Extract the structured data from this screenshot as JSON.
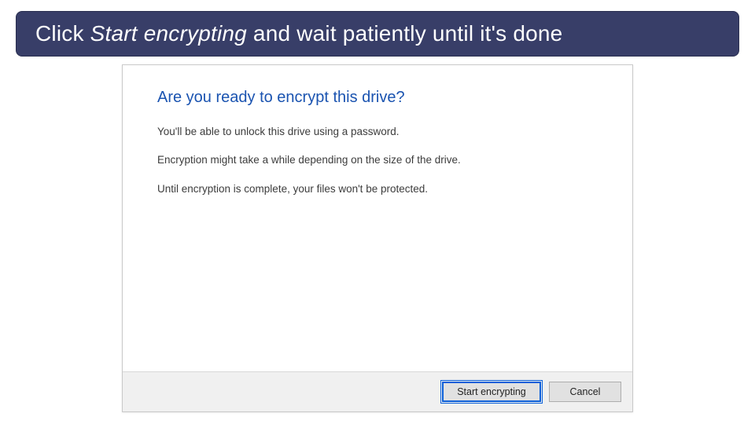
{
  "banner": {
    "pre": "Click ",
    "em": "Start encrypting",
    "post": " and wait patiently until it's done"
  },
  "dialog": {
    "heading": "Are you ready to encrypt this drive?",
    "line1": "You'll be able to unlock this drive using a password.",
    "line2": "Encryption might take a while depending on the size of the drive.",
    "line3": "Until encryption is complete, your files won't be protected.",
    "buttons": {
      "primary": "Start encrypting",
      "cancel": "Cancel"
    }
  }
}
